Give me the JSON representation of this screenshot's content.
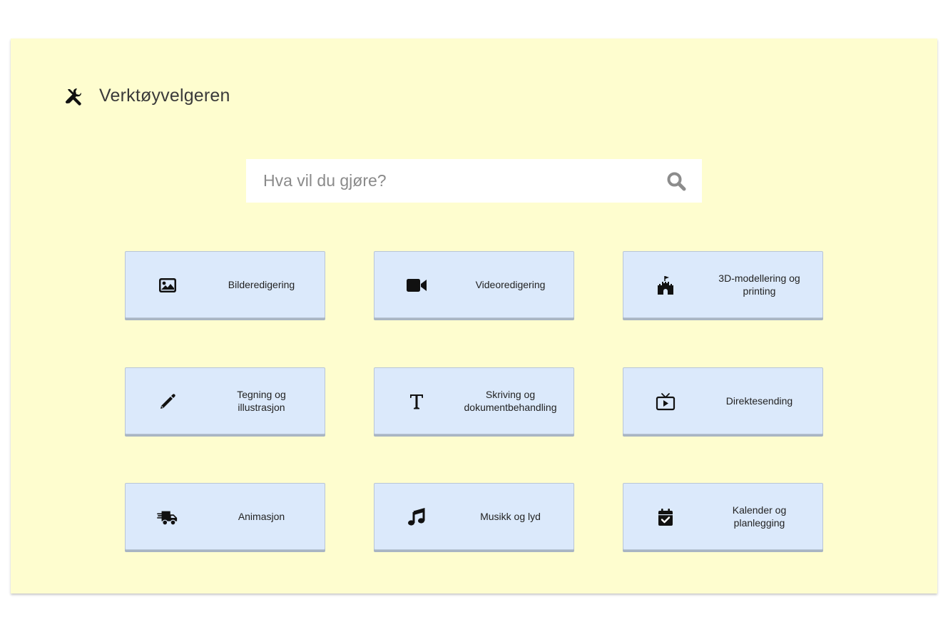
{
  "header": {
    "title": "Verktøyvelgeren",
    "icon": "tools-icon"
  },
  "search": {
    "placeholder": "Hva vil du gjøre?",
    "value": "",
    "icon": "search-icon"
  },
  "categories": [
    {
      "label": "Bilderedigering",
      "icon": "image-icon"
    },
    {
      "label": "Videoredigering",
      "icon": "video-camera-icon"
    },
    {
      "label": "3D-modellering og\nprinting",
      "icon": "castle-icon"
    },
    {
      "label": "Tegning og\nillustrasjon",
      "icon": "pencil-icon"
    },
    {
      "label": "Skriving og\ndokumentbehandling",
      "icon": "text-icon"
    },
    {
      "label": "Direktesending",
      "icon": "live-tv-icon"
    },
    {
      "label": "Animasjon",
      "icon": "shipping-fast-icon"
    },
    {
      "label": "Musikk og lyd",
      "icon": "music-note-icon"
    },
    {
      "label": "Kalender og\nplanlegging",
      "icon": "calendar-check-icon"
    }
  ],
  "colors": {
    "background": "#fefdcf",
    "card": "#dbe9fb",
    "icon": "#111111"
  }
}
